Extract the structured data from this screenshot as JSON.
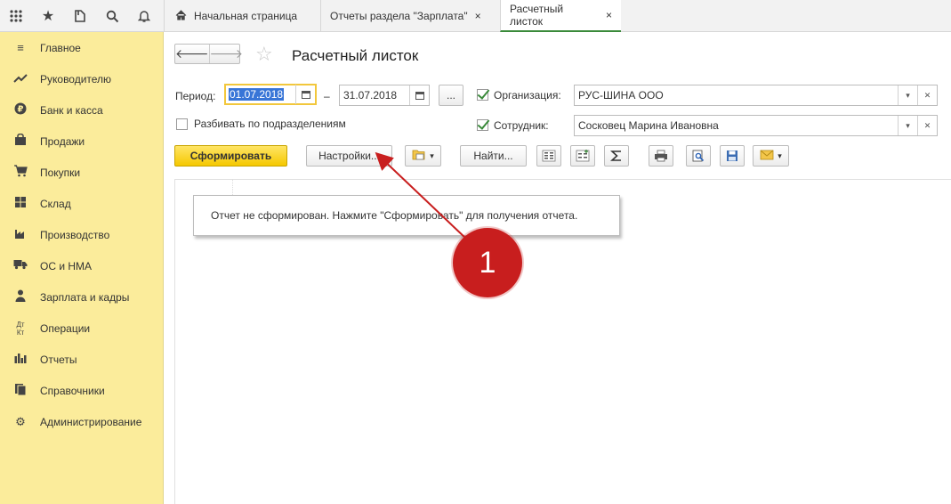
{
  "tabs": [
    {
      "label": "Начальная страница"
    },
    {
      "label": "Отчеты раздела \"Зарплата\"",
      "close": "×"
    },
    {
      "label": "Расчетный листок",
      "close": "×"
    }
  ],
  "sidebar": {
    "items": [
      {
        "label": "Главное",
        "icon": "menu-icon"
      },
      {
        "label": "Руководителю",
        "icon": "trend-icon"
      },
      {
        "label": "Банк и касса",
        "icon": "ruble-icon"
      },
      {
        "label": "Продажи",
        "icon": "bag-icon"
      },
      {
        "label": "Покупки",
        "icon": "cart-icon"
      },
      {
        "label": "Склад",
        "icon": "warehouse-icon"
      },
      {
        "label": "Производство",
        "icon": "factory-icon"
      },
      {
        "label": "ОС и НМА",
        "icon": "truck-icon"
      },
      {
        "label": "Зарплата и кадры",
        "icon": "person-icon"
      },
      {
        "label": "Операции",
        "icon": "dt-kt-icon",
        "glyph": "Дт Кт"
      },
      {
        "label": "Отчеты",
        "icon": "bar-chart-icon"
      },
      {
        "label": "Справочники",
        "icon": "books-icon"
      },
      {
        "label": "Администрирование",
        "icon": "gear-icon"
      }
    ]
  },
  "form": {
    "title": "Расчетный листок",
    "period_label": "Период:",
    "date_from": "01.07.2018",
    "dash": "–",
    "date_to": "31.07.2018",
    "more_btn": "...",
    "split_label": "Разбивать по подразделениям",
    "split_checked": false,
    "org_label": "Организация:",
    "org_value": "РУС-ШИНА ООО",
    "org_checked": true,
    "employee_label": "Сотрудник:",
    "employee_value": "Сосковец Марина Ивановна",
    "employee_checked": true
  },
  "toolbar": {
    "generate": "Сформировать",
    "settings": "Настройки...",
    "find": "Найти..."
  },
  "report": {
    "message": "Отчет не сформирован. Нажмите \"Сформировать\" для получения отчета."
  },
  "annotation": {
    "number": "1",
    "color": "#c81e1e"
  }
}
